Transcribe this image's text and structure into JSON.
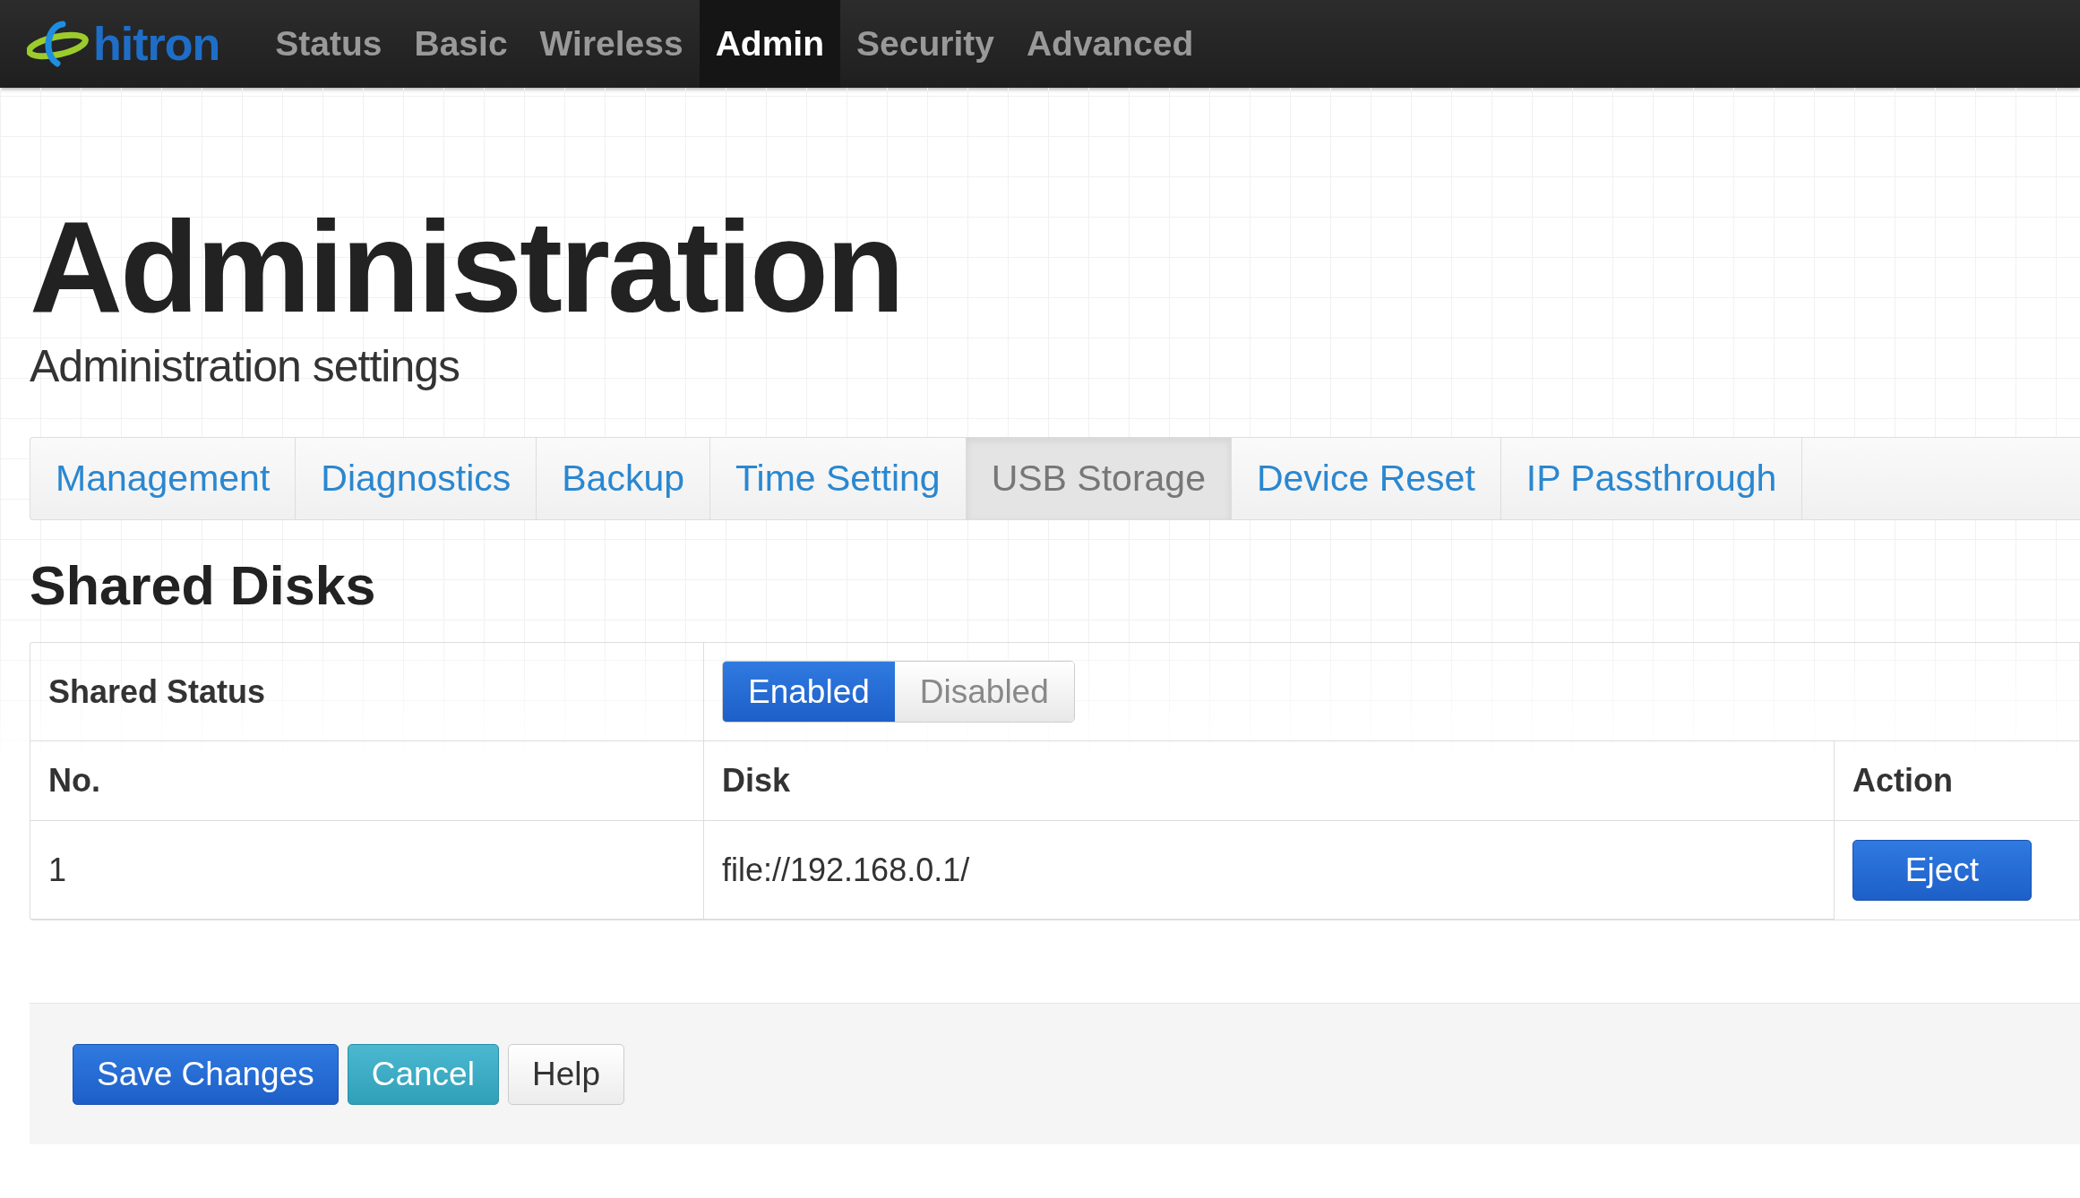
{
  "nav": {
    "logo": "hitron",
    "items": [
      {
        "label": "Status",
        "selected": false
      },
      {
        "label": "Basic",
        "selected": false
      },
      {
        "label": "Wireless",
        "selected": false
      },
      {
        "label": "Admin",
        "selected": true
      },
      {
        "label": "Security",
        "selected": false
      },
      {
        "label": "Advanced",
        "selected": false
      }
    ]
  },
  "header": {
    "title": "Administration",
    "subtitle": "Administration settings"
  },
  "tabs": [
    {
      "label": "Management",
      "selected": false
    },
    {
      "label": "Diagnostics",
      "selected": false
    },
    {
      "label": "Backup",
      "selected": false
    },
    {
      "label": "Time Setting",
      "selected": false
    },
    {
      "label": "USB Storage",
      "selected": true
    },
    {
      "label": "Device Reset",
      "selected": false
    },
    {
      "label": "IP Passthrough",
      "selected": false
    }
  ],
  "section_title": "Shared Disks",
  "shared_status": {
    "label": "Shared Status",
    "options": [
      {
        "label": "Enabled",
        "selected": true
      },
      {
        "label": "Disabled",
        "selected": false
      }
    ]
  },
  "table": {
    "columns": [
      "No.",
      "Disk",
      "Action"
    ],
    "rows": [
      {
        "no": "1",
        "disk": "file://192.168.0.1/",
        "action": "Eject"
      }
    ]
  },
  "buttons": [
    {
      "label": "Save Changes",
      "kind": "primary"
    },
    {
      "label": "Cancel",
      "kind": "info"
    },
    {
      "label": "Help",
      "kind": "default"
    }
  ]
}
